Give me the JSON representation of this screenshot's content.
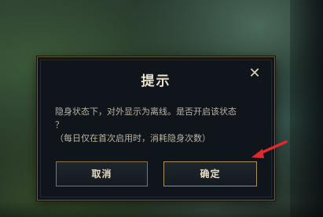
{
  "dialog": {
    "title": "提示",
    "close_symbol": "✕",
    "message_line1": "隐身状态下，对外显示为离线。是否开启该状态",
    "message_line2": "？",
    "message_line3": "（每日仅在首次启用时，消耗隐身次数）",
    "cancel_label": "取消",
    "confirm_label": "确定"
  },
  "annotation": {
    "arrow_color": "#e0282e",
    "arrow_icon": "red-arrow-pointing-to-confirm"
  }
}
